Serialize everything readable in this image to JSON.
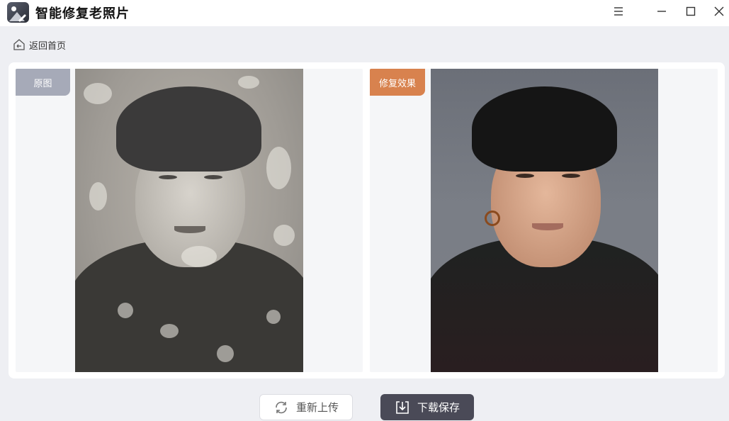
{
  "app": {
    "title": "智能修复老照片"
  },
  "nav": {
    "back_label": "返回首页"
  },
  "panels": {
    "original_tag": "原图",
    "restored_tag": "修复效果"
  },
  "actions": {
    "reupload_label": "重新上传",
    "download_label": "下载保存"
  },
  "colors": {
    "original_tag": "#a6aab8",
    "restored_tag": "#d8824e",
    "download_button": "#4a4a57",
    "background": "#eeeff3"
  },
  "icons": {
    "menu": "hamburger-icon",
    "minimize": "minimize-icon",
    "maximize": "maximize-icon",
    "close": "close-icon",
    "back": "home-back-icon",
    "reupload": "refresh-icon",
    "download": "download-icon"
  }
}
